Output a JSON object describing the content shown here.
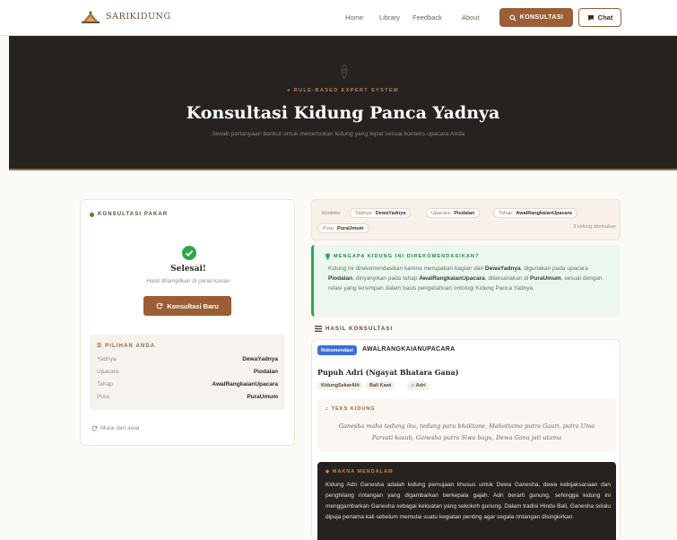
{
  "nav": {
    "brand": "SARIKIDUNG",
    "links": [
      "Home",
      "Library",
      "Feedback",
      "About"
    ],
    "konsultasi_label": "KONSULTASI",
    "chat_label": "Chat"
  },
  "hero": {
    "tagline": "RULE-BASED EXPERT SYSTEM",
    "title": "Konsultasi Kidung Panca Yadnya",
    "subtitle": "Jawab pertanyaan berikut untuk menemukan kidung yang tepat sesuai konteks upacara Anda"
  },
  "left": {
    "section_title": "KONSULTASI PAKAR",
    "done_title": "Selesai!",
    "done_sub": "Hasil ditampilkan di panel kanan",
    "new_button": "Konsultasi Baru",
    "pilihan_title": "PILIHAN ANDA",
    "pilihan": [
      {
        "key": "Yadnya",
        "value": "DewaYadnya"
      },
      {
        "key": "Upacara",
        "value": "Piodalan"
      },
      {
        "key": "Tahap",
        "value": "AwalRangkaianUpacara"
      },
      {
        "key": "Pura",
        "value": "PuraUmum"
      }
    ],
    "restart": "Mulai dari awal"
  },
  "context": {
    "chips": [
      {
        "key": "Konteks:",
        "value": ""
      },
      {
        "key": "Yadnya:",
        "value": "DewaYadnya"
      },
      {
        "key": "Upacara:",
        "value": "Piodalan"
      },
      {
        "key": "Tahap:",
        "value": "AwalRangkaianUpacara"
      },
      {
        "key": "Pura:",
        "value": "PuraUmum"
      }
    ],
    "found": "3 kidung ditemukan"
  },
  "why": {
    "title": "MENGAPA KIDUNG INI DIREKOMENDASIKAN?",
    "p1": "Kidung ini direkomendasikan karena merupakan bagian dari ",
    "b1": "DewaYadnya",
    "p2": ", digunakan pada upacara ",
    "b2": "Piodalan",
    "p3": ", dinyanyikan pada tahap ",
    "b3": "AwalRangkaianUpacara",
    "p4": ", dilaksanakan di ",
    "b4": "PuraUmum",
    "p5": ", sesuai dengan relasi yang tersimpan dalam basis pengetahuan ontologi Kidung Panca Yadnya."
  },
  "hasil": {
    "section_title": "HASIL KONSULTASI",
    "badge": "Rekomendasi",
    "upacara": "AWALRANGKAIANUPACARA",
    "pupuh": "Pupuh Adri (Ngayat Bhatara Gana)",
    "tags": [
      "KidungSekarAlit",
      "Bali Kawi",
      "Adri"
    ],
    "teks_title": "TEKS KIDUNG",
    "teks_body": "Ganesha maha tedung iku, tedung para bhaktane, Mahottama putra Gauri, putra Uma Parvati kasub, Ganesha putra Siwa bagu, Dewa Gana jati utama",
    "makna_title": "MAKNA MENDALAM",
    "makna_body": "Kidung Adri Ganesha adalah kidung pemujaan khusus untuk Dewa Ganesha, dewa kebijaksanaan dan penghilang rintangan yang digambarkan berkepala gajah. Adri berarti gunung, sehingga kidung ini menggambarkan Ganesha sebagai kekuatan yang sekokoh gunung. Dalam tradisi Hindu Bali, Ganesha selalu dipuja pertama kali sebelum memulai suatu kegiatan penting agar segala rintangan disingkirkan."
  },
  "colors": {
    "accent": "#9b5e35",
    "hero_bg": "#262220",
    "success": "#2aa84a",
    "badge": "#3b6fd6"
  }
}
